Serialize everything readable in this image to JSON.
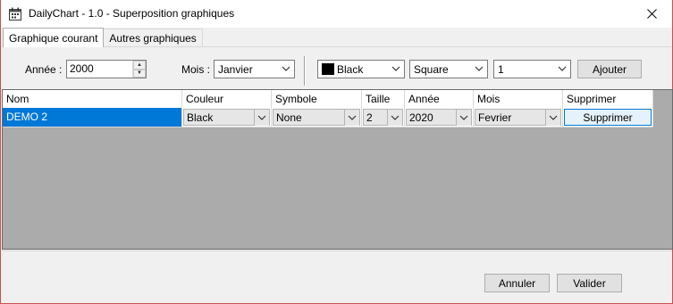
{
  "window": {
    "title": "DailyChart - 1.0 - Superposition graphiques",
    "icon": "calendar-icon"
  },
  "tabs": [
    {
      "label": "Graphique courant",
      "active": true
    },
    {
      "label": "Autres graphiques",
      "active": false
    }
  ],
  "controls": {
    "annee_label": "Année :",
    "annee_value": "2000",
    "mois_label": "Mois :",
    "mois_value": "Janvier",
    "color_value": "Black",
    "color_hex": "#000000",
    "symbol_value": "Square",
    "size_value": "1",
    "add_label": "Ajouter"
  },
  "grid": {
    "columns": [
      "Nom",
      "Couleur",
      "Symbole",
      "Taille",
      "Année",
      "Mois",
      "Supprimer"
    ],
    "rows": [
      {
        "nom": "DEMO 2",
        "couleur": "Black",
        "symbole": "None",
        "taille": "2",
        "annee": "2020",
        "mois": "Fevrier",
        "supprimer": "Supprimer"
      }
    ],
    "selection_color": "#0078d7",
    "background_color": "#ababab"
  },
  "footer": {
    "cancel_label": "Annuler",
    "ok_label": "Valider"
  }
}
